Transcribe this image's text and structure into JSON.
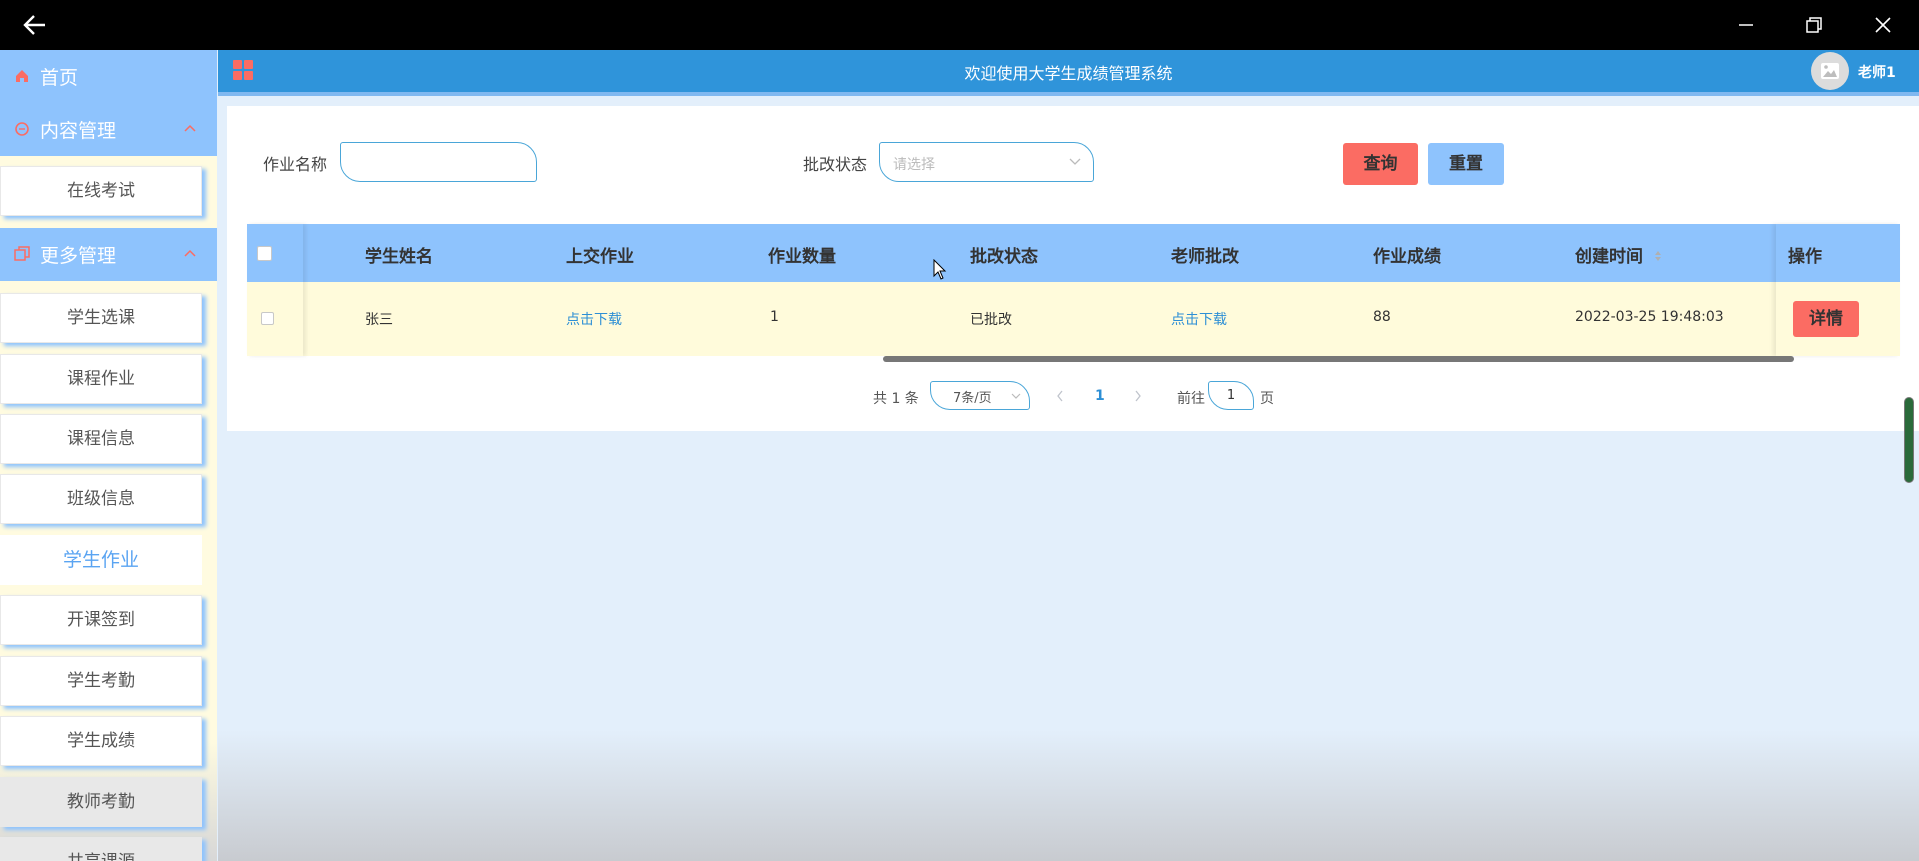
{
  "window": {
    "back_icon": "arrow-left-icon",
    "controls": [
      "minimize-icon",
      "restore-icon",
      "close-icon"
    ]
  },
  "sidebar": {
    "home": "首页",
    "groups": [
      {
        "label": "内容管理",
        "items": [
          "在线考试"
        ]
      },
      {
        "label": "更多管理",
        "items": [
          "学生选课",
          "课程作业",
          "课程信息",
          "班级信息",
          "学生作业",
          "开课签到",
          "学生考勤",
          "学生成绩",
          "教师考勤",
          "共享课源"
        ]
      }
    ],
    "active": "学生作业"
  },
  "header": {
    "title": "欢迎使用大学生成绩管理系统",
    "user": "老师1"
  },
  "search": {
    "name_label": "作业名称",
    "name_value": "",
    "status_label": "批改状态",
    "status_placeholder": "请选择",
    "query_btn": "查询",
    "reset_btn": "重置"
  },
  "table": {
    "columns": [
      "学生姓名",
      "上交作业",
      "作业数量",
      "批改状态",
      "老师批改",
      "作业成绩",
      "创建时间",
      "操作"
    ],
    "rows": [
      {
        "student": "张三",
        "submit": "点击下载",
        "count": "1",
        "status": "已批改",
        "teacher_review": "点击下载",
        "score": "88",
        "created": "2022-03-25 19:48:03",
        "action": "详情"
      }
    ]
  },
  "pagination": {
    "total": "共 1 条",
    "page_size": "7条/页",
    "current": "1",
    "goto_prefix": "前往",
    "goto_value": "1",
    "goto_suffix": "页"
  },
  "colors": {
    "accent": "#2f94da",
    "sidebar_header": "#8ec3fd",
    "danger": "#fb6c63",
    "row_bg": "#fffbdb"
  }
}
